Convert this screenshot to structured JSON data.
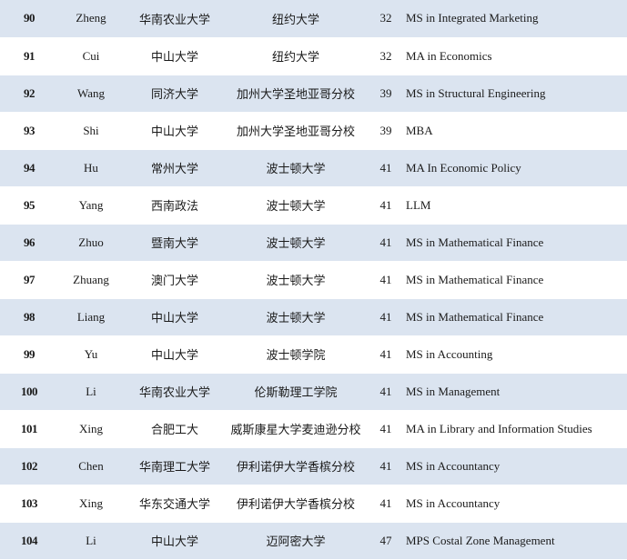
{
  "rows": [
    {
      "rank": "90",
      "name": "Zheng",
      "undergrad": "华南农业大学",
      "grad": "纽约大学",
      "num": "32",
      "program": "MS in Integrated Marketing"
    },
    {
      "rank": "91",
      "name": "Cui",
      "undergrad": "中山大学",
      "grad": "纽约大学",
      "num": "32",
      "program": "MA in Economics"
    },
    {
      "rank": "92",
      "name": "Wang",
      "undergrad": "同济大学",
      "grad": "加州大学圣地亚哥分校",
      "num": "39",
      "program": "MS in Structural Engineering"
    },
    {
      "rank": "93",
      "name": "Shi",
      "undergrad": "中山大学",
      "grad": "加州大学圣地亚哥分校",
      "num": "39",
      "program": "MBA"
    },
    {
      "rank": "94",
      "name": "Hu",
      "undergrad": "常州大学",
      "grad": "波士顿大学",
      "num": "41",
      "program": "MA In Economic Policy"
    },
    {
      "rank": "95",
      "name": "Yang",
      "undergrad": "西南政法",
      "grad": "波士顿大学",
      "num": "41",
      "program": "LLM"
    },
    {
      "rank": "96",
      "name": "Zhuo",
      "undergrad": "暨南大学",
      "grad": "波士顿大学",
      "num": "41",
      "program": "MS in Mathematical Finance"
    },
    {
      "rank": "97",
      "name": "Zhuang",
      "undergrad": "澳门大学",
      "grad": "波士顿大学",
      "num": "41",
      "program": "MS in Mathematical Finance"
    },
    {
      "rank": "98",
      "name": "Liang",
      "undergrad": "中山大学",
      "grad": "波士顿大学",
      "num": "41",
      "program": "MS in Mathematical Finance"
    },
    {
      "rank": "99",
      "name": "Yu",
      "undergrad": "中山大学",
      "grad": "波士顿学院",
      "num": "41",
      "program": "MS in Accounting"
    },
    {
      "rank": "100",
      "name": "Li",
      "undergrad": "华南农业大学",
      "grad": "伦斯勒理工学院",
      "num": "41",
      "program": "MS in Management"
    },
    {
      "rank": "101",
      "name": "Xing",
      "undergrad": "合肥工大",
      "grad": "威斯康星大学麦迪逊分校",
      "num": "41",
      "program": "MA in Library and Information Studies"
    },
    {
      "rank": "102",
      "name": "Chen",
      "undergrad": "华南理工大学",
      "grad": "伊利诺伊大学香槟分校",
      "num": "41",
      "program": "MS in Accountancy"
    },
    {
      "rank": "103",
      "name": "Xing",
      "undergrad": "华东交通大学",
      "grad": "伊利诺伊大学香槟分校",
      "num": "41",
      "program": "MS in Accountancy"
    },
    {
      "rank": "104",
      "name": "Li",
      "undergrad": "中山大学",
      "grad": "迈阿密大学",
      "num": "47",
      "program": "MPS Costal Zone Management"
    }
  ],
  "colors": {
    "row_alt": "#dbe4f0",
    "row_plain": "#ffffff",
    "rank_text": "#1f3864"
  }
}
